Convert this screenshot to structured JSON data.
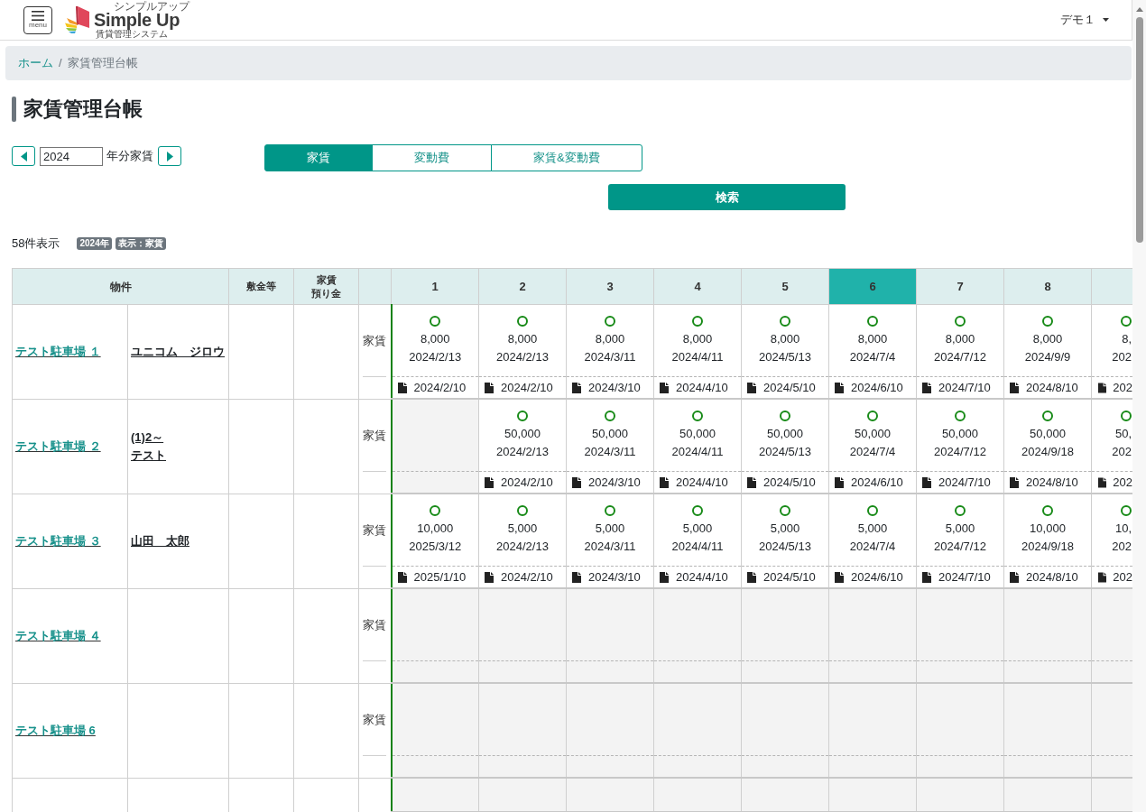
{
  "header": {
    "menu_button": {
      "caption": "menu"
    },
    "logo": {
      "ruby": "シンプルアップ",
      "name": "Simple Up",
      "tagline": "賃貸管理システム"
    },
    "user_menu": "デモ１"
  },
  "breadcrumb": {
    "divider": "/",
    "items": [
      {
        "label": "ホーム",
        "link": true
      },
      {
        "label": "家賃管理台帳",
        "link": false
      }
    ]
  },
  "page_title": "家賃管理台帳",
  "year_selector": {
    "value": "2024",
    "suffix": "年分家賃"
  },
  "tabs": [
    {
      "label": "家賃",
      "selected": true
    },
    {
      "label": "変動費",
      "selected": false
    },
    {
      "label": "家賃&変動費",
      "selected": false
    }
  ],
  "search_button": "検索",
  "result_count": "58件表示",
  "filter_badges": [
    "2024年",
    "表示：家賃"
  ],
  "table": {
    "columns": {
      "property": "物件",
      "deposit": "敷金等",
      "rent_deposit": [
        "家賃",
        "預り金"
      ]
    },
    "months": [
      {
        "label": "1",
        "selected": false
      },
      {
        "label": "2",
        "selected": false
      },
      {
        "label": "3",
        "selected": false
      },
      {
        "label": "4",
        "selected": false
      },
      {
        "label": "5",
        "selected": false
      },
      {
        "label": "6",
        "selected": true
      },
      {
        "label": "7",
        "selected": false
      },
      {
        "label": "8",
        "selected": false
      },
      {
        "selected": false
      }
    ],
    "rows": [
      {
        "property": "テスト駐車場 １",
        "tenant": [
          "ユニコム　ジロウ"
        ],
        "label": "家賃",
        "months": [
          {
            "kind": "paid",
            "amount": "8,000",
            "paid_on": "2024/2/13",
            "billed_on": "2024/2/10"
          },
          {
            "kind": "paid",
            "amount": "8,000",
            "paid_on": "2024/2/13",
            "billed_on": "2024/2/10"
          },
          {
            "kind": "paid",
            "amount": "8,000",
            "paid_on": "2024/3/11",
            "billed_on": "2024/3/10"
          },
          {
            "kind": "paid",
            "amount": "8,000",
            "paid_on": "2024/4/11",
            "billed_on": "2024/4/10"
          },
          {
            "kind": "paid",
            "amount": "8,000",
            "paid_on": "2024/5/13",
            "billed_on": "2024/5/10"
          },
          {
            "kind": "paid",
            "amount": "8,000",
            "paid_on": "2024/7/4",
            "billed_on": "2024/6/10"
          },
          {
            "kind": "paid",
            "amount": "8,000",
            "paid_on": "2024/7/12",
            "billed_on": "2024/7/10"
          },
          {
            "kind": "paid",
            "amount": "8,000",
            "paid_on": "2024/9/9",
            "billed_on": "2024/8/10"
          },
          {
            "kind": "paid",
            "amount": "8,",
            "paid_on": "202",
            "billed_on": "202"
          }
        ]
      },
      {
        "property": "テスト駐車場 ２",
        "tenant": [
          "(1)2～",
          "テスト"
        ],
        "label": "家賃",
        "months": [
          {
            "kind": "none"
          },
          {
            "kind": "paid",
            "amount": "50,000",
            "paid_on": "2024/2/13",
            "billed_on": "2024/2/10"
          },
          {
            "kind": "paid",
            "amount": "50,000",
            "paid_on": "2024/3/11",
            "billed_on": "2024/3/10"
          },
          {
            "kind": "paid",
            "amount": "50,000",
            "paid_on": "2024/4/11",
            "billed_on": "2024/4/10"
          },
          {
            "kind": "paid",
            "amount": "50,000",
            "paid_on": "2024/5/13",
            "billed_on": "2024/5/10"
          },
          {
            "kind": "paid",
            "amount": "50,000",
            "paid_on": "2024/7/4",
            "billed_on": "2024/6/10"
          },
          {
            "kind": "paid",
            "amount": "50,000",
            "paid_on": "2024/7/12",
            "billed_on": "2024/7/10"
          },
          {
            "kind": "paid",
            "amount": "50,000",
            "paid_on": "2024/9/18",
            "billed_on": "2024/8/10"
          },
          {
            "kind": "paid",
            "amount": "50,",
            "paid_on": "202",
            "billed_on": "202"
          }
        ]
      },
      {
        "property": "テスト駐車場 ３",
        "tenant": [
          "山田　太郎"
        ],
        "label": "家賃",
        "months": [
          {
            "kind": "paid",
            "amount": "10,000",
            "paid_on": "2025/3/12",
            "billed_on": "2025/1/10"
          },
          {
            "kind": "paid",
            "amount": "5,000",
            "paid_on": "2024/2/13",
            "billed_on": "2024/2/10"
          },
          {
            "kind": "paid",
            "amount": "5,000",
            "paid_on": "2024/3/11",
            "billed_on": "2024/3/10"
          },
          {
            "kind": "paid",
            "amount": "5,000",
            "paid_on": "2024/4/11",
            "billed_on": "2024/4/10"
          },
          {
            "kind": "paid",
            "amount": "5,000",
            "paid_on": "2024/5/13",
            "billed_on": "2024/5/10"
          },
          {
            "kind": "paid",
            "amount": "5,000",
            "paid_on": "2024/7/4",
            "billed_on": "2024/6/10"
          },
          {
            "kind": "paid",
            "amount": "5,000",
            "paid_on": "2024/7/12",
            "billed_on": "2024/7/10"
          },
          {
            "kind": "paid",
            "amount": "10,000",
            "paid_on": "2024/9/18",
            "billed_on": "2024/8/10"
          },
          {
            "kind": "paid",
            "amount": "10,",
            "paid_on": "202",
            "billed_on": "202"
          }
        ]
      },
      {
        "property": "テスト駐車場 ４",
        "label": "家賃",
        "months": [
          {
            "kind": "none"
          },
          {
            "kind": "none"
          },
          {
            "kind": "none"
          },
          {
            "kind": "none"
          },
          {
            "kind": "none"
          },
          {
            "kind": "none"
          },
          {
            "kind": "none"
          },
          {
            "kind": "none"
          },
          {
            "kind": "none"
          }
        ]
      },
      {
        "property": "テスト駐車場 6",
        "label": "家賃",
        "months": [
          {
            "kind": "none"
          },
          {
            "kind": "none"
          },
          {
            "kind": "none"
          },
          {
            "kind": "none"
          },
          {
            "kind": "none"
          },
          {
            "kind": "none"
          },
          {
            "kind": "none"
          },
          {
            "kind": "none"
          },
          {
            "kind": "none"
          }
        ]
      },
      {
        "months": [
          {
            "kind": "none"
          },
          {
            "kind": "none"
          },
          {
            "kind": "none"
          },
          {
            "kind": "none"
          },
          {
            "kind": "none"
          },
          {
            "kind": "none"
          },
          {
            "kind": "none"
          },
          {
            "kind": "none"
          },
          {
            "kind": "none"
          }
        ]
      }
    ]
  }
}
